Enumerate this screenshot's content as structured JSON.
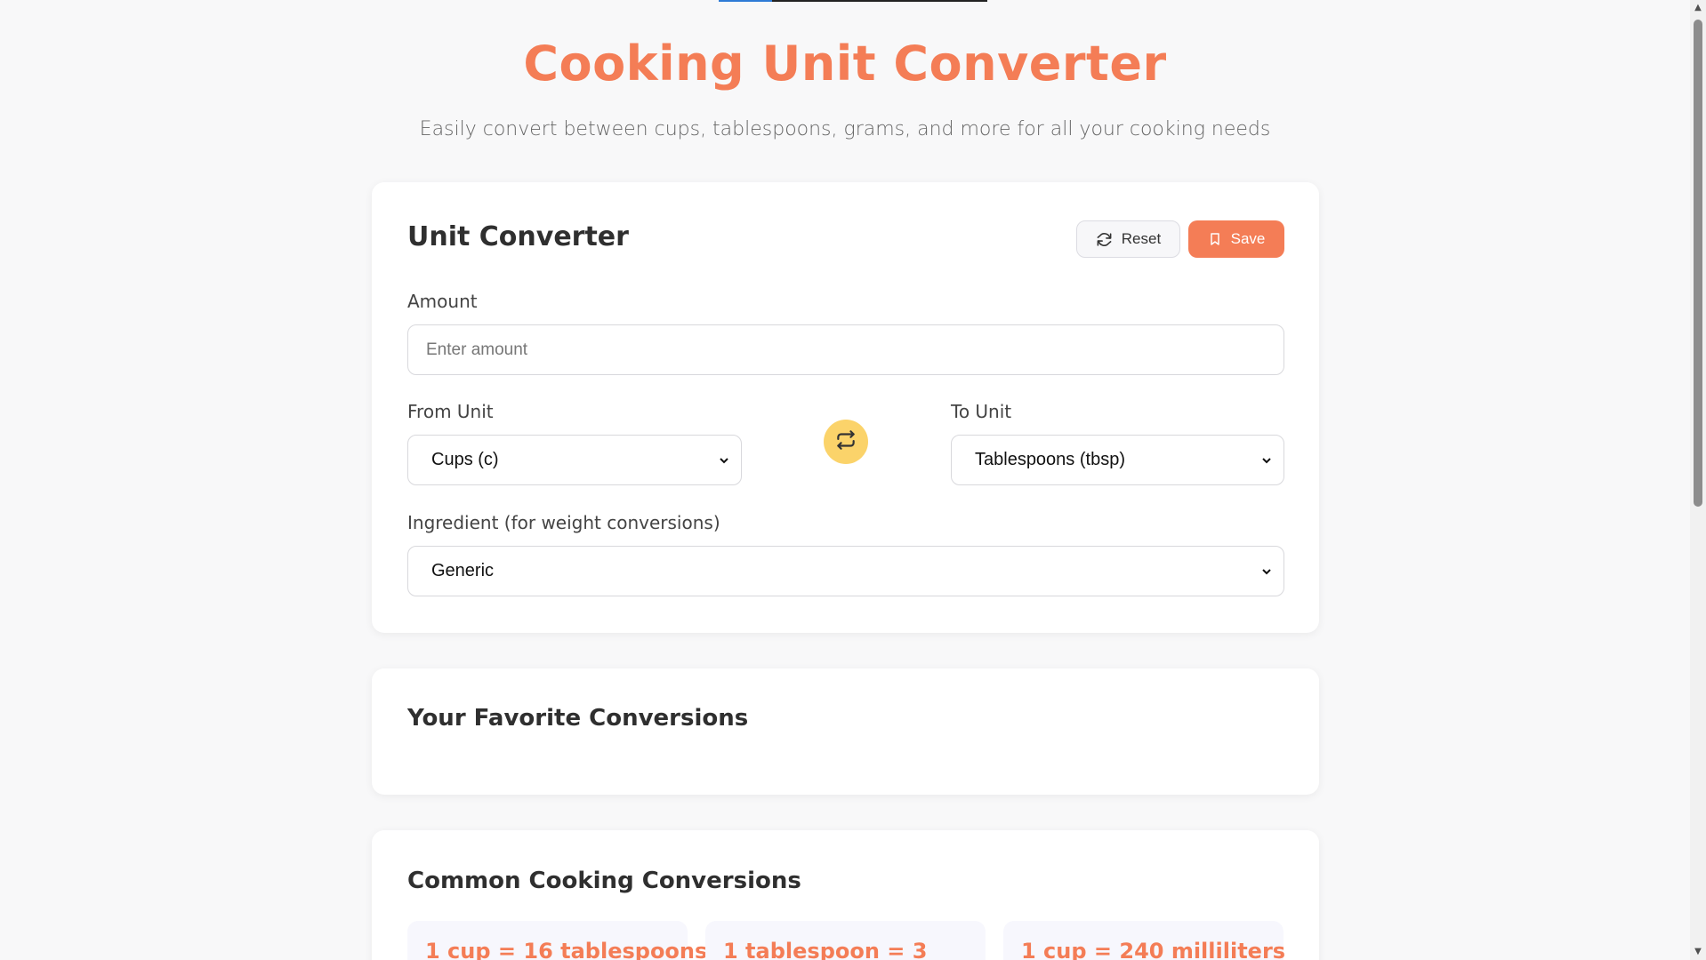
{
  "header": {
    "title": "Cooking Unit Converter",
    "subtitle": "Easily convert between cups, tablespoons, grams, and more for all your cooking needs",
    "progress_fraction": 0.2
  },
  "converter": {
    "title": "Unit Converter",
    "reset_label": "Reset",
    "save_label": "Save",
    "amount_label": "Amount",
    "amount_placeholder": "Enter amount",
    "amount_value": "",
    "from_label": "From Unit",
    "from_value": "Cups (c)",
    "to_label": "To Unit",
    "to_value": "Tablespoons (tbsp)",
    "ingredient_label": "Ingredient (for weight conversions)",
    "ingredient_value": "Generic"
  },
  "favorites": {
    "title": "Your Favorite Conversions"
  },
  "common": {
    "title": "Common Cooking Conversions",
    "items": [
      "1 cup = 16 tablespoons",
      "1 tablespoon = 3",
      "1 cup = 240 milliliters"
    ]
  },
  "colors": {
    "accent": "#f47d56",
    "swap": "#fbd36a",
    "background": "#f8f8f9"
  },
  "icons": {
    "reset": "refresh-icon",
    "save": "bookmark-icon",
    "swap": "swap-arrows-icon",
    "select": "chevron-down-icon"
  }
}
